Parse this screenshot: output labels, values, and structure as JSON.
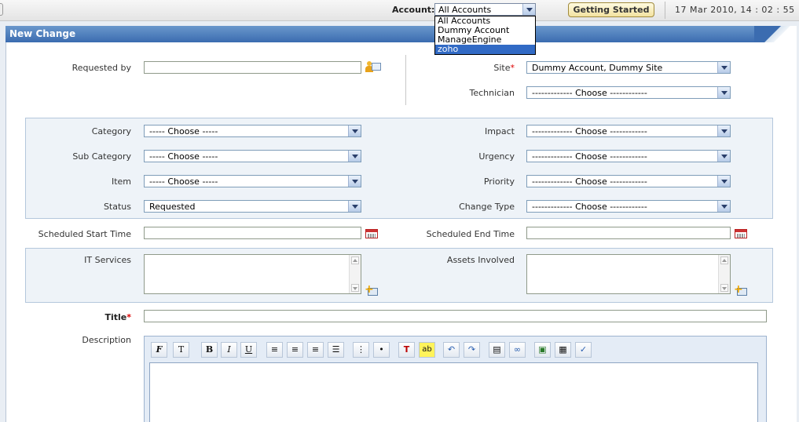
{
  "topbar": {
    "account_label": "Account:",
    "account_selected": "All Accounts",
    "account_options": [
      "All Accounts",
      "Dummy Account",
      "ManageEngine",
      "zoho"
    ],
    "account_highlighted": "zoho",
    "getting_started_label": "Getting Started",
    "datetime": "17 Mar 2010, 14 : 02 : 55"
  },
  "panel": {
    "title": "New Change"
  },
  "form": {
    "requested_by": {
      "label": "Requested by",
      "value": ""
    },
    "site": {
      "label": "Site",
      "required": "*",
      "value": "Dummy Account, Dummy Site"
    },
    "technician": {
      "label": "Technician",
      "value": "------------- Choose ------------"
    },
    "category": {
      "label": "Category",
      "value": "----- Choose -----"
    },
    "sub_category": {
      "label": "Sub Category",
      "value": "----- Choose -----"
    },
    "item": {
      "label": "Item",
      "value": "----- Choose -----"
    },
    "status": {
      "label": "Status",
      "value": "Requested"
    },
    "impact": {
      "label": "Impact",
      "value": "------------- Choose ------------"
    },
    "urgency": {
      "label": "Urgency",
      "value": "------------- Choose ------------"
    },
    "priority": {
      "label": "Priority",
      "value": "------------- Choose ------------"
    },
    "change_type": {
      "label": "Change Type",
      "value": "------------- Choose ------------"
    },
    "scheduled_start": {
      "label": "Scheduled Start Time",
      "value": ""
    },
    "scheduled_end": {
      "label": "Scheduled End Time",
      "value": ""
    },
    "it_services": {
      "label": "IT Services"
    },
    "assets_involved": {
      "label": "Assets Involved"
    },
    "title_field": {
      "label": "Title",
      "required": "*",
      "value": ""
    },
    "description": {
      "label": "Description"
    }
  },
  "editor_toolbar": {
    "font": "F",
    "font_size": "T",
    "bold": "B",
    "italic": "I",
    "underline": "U",
    "text_color": "T",
    "highlight": "ab"
  },
  "colors": {
    "header_blue": "#3b6cb0",
    "group_bg": "#eef3f8",
    "selected_option": "#316ac5",
    "required_star": "#dd0000"
  }
}
